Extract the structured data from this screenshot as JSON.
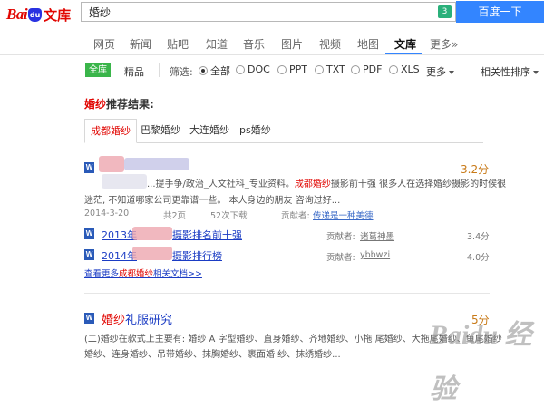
{
  "header": {
    "logo_text": "Baidu文库",
    "logo_bai": "Bai",
    "logo_du": "du",
    "logo_wenku": "文库",
    "search_value": "婚纱",
    "search_badge": "3",
    "search_button": "百度一下"
  },
  "nav": {
    "items": [
      {
        "label": "网页"
      },
      {
        "label": "新闻"
      },
      {
        "label": "贴吧"
      },
      {
        "label": "知道"
      },
      {
        "label": "音乐"
      },
      {
        "label": "图片"
      },
      {
        "label": "视频"
      },
      {
        "label": "地图"
      },
      {
        "label": "文库"
      },
      {
        "label": "更多»"
      }
    ],
    "active": "文库"
  },
  "filter": {
    "all_library": "全库",
    "featured": "精品",
    "filter_label": "筛选:",
    "formats": [
      {
        "label": "全部",
        "selected": true
      },
      {
        "label": "DOC",
        "selected": false
      },
      {
        "label": "PPT",
        "selected": false
      },
      {
        "label": "TXT",
        "selected": false
      },
      {
        "label": "PDF",
        "selected": false
      },
      {
        "label": "XLS",
        "selected": false
      }
    ],
    "more": "更多",
    "sort": "相关性排序"
  },
  "recommend": {
    "keyword": "婚纱",
    "title_suffix": "推荐结果:",
    "tabs": [
      {
        "label": "成都婚纱"
      },
      {
        "label": "巴黎婚纱"
      },
      {
        "label": "大连婚纱"
      },
      {
        "label": "ps婚纱"
      }
    ]
  },
  "results": [
    {
      "score": "3.2分",
      "line1_a": "...提手争/政治_人文社科_专业资料。",
      "line1_kw": "成都婚纱",
      "line1_b": "摄影前十强 很多人在选择婚纱摄影的时候很",
      "line2": "迷茫, 不知道哪家公司更靠谱一些。 本人身边的朋友 咨询过好...",
      "meta_date": "2014-3-20",
      "meta_pages": "共2页",
      "meta_views": "52次下载",
      "meta_contributor_label": "贡献者:",
      "meta_contributor": "传递是一种美德",
      "subdocs": [
        {
          "prefix": "2013年",
          "title": "摄影排名前十强",
          "contributor_label": "贡献者:",
          "contributor": "诸葛神墨",
          "score": "3.4分"
        },
        {
          "prefix": "2014年",
          "title": "摄影排行榜",
          "contributor_label": "贡献者:",
          "contributor": "ybbwzi",
          "score": "4.0分"
        }
      ],
      "more_a": "查看更多",
      "more_kw": "成都婚纱",
      "more_b": "相关文档>>"
    },
    {
      "title_kw": "婚纱",
      "title_rest": "礼服研究",
      "score": "5分",
      "line1": "(二)婚纱在款式上主要有: 婚纱 A 字型婚纱、直身婚纱、齐地婚纱、小拖 尾婚纱、大拖尾婚纱、鱼尾婚纱",
      "line2": "婚纱、连身婚纱、吊带婚纱、抹胸婚纱、裹面婚 纱、抹绣婚纱..."
    }
  ],
  "watermark": "Baidu 经验"
}
